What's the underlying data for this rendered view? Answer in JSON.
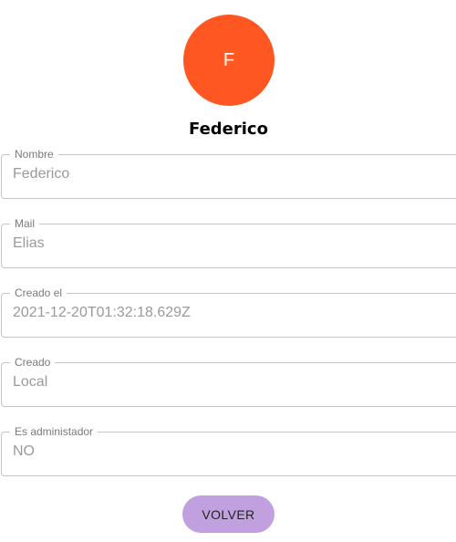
{
  "profile": {
    "avatar_initial": "F",
    "avatar_color": "#ff5722",
    "name": "Federico"
  },
  "fields": [
    {
      "label": "Nombre",
      "value": "Federico"
    },
    {
      "label": "Mail",
      "value": "Elias"
    },
    {
      "label": "Creado el",
      "value": "2021-12-20T01:32:18.629Z"
    },
    {
      "label": "Creado",
      "value": "Local"
    },
    {
      "label": "Es administador",
      "value": "NO"
    }
  ],
  "actions": {
    "back_label": "VOLVER",
    "back_color": "#c0a0de"
  }
}
